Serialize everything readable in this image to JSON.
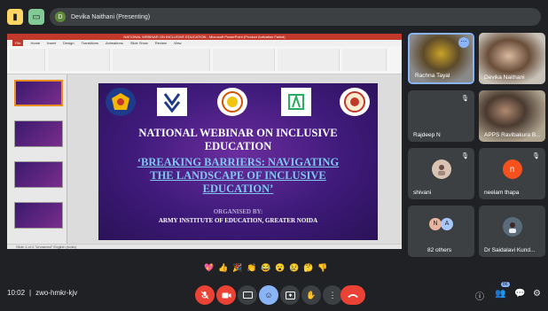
{
  "topbar": {
    "presenter_initial": "D",
    "presenting_label": "Devika Naithani (Presenting)"
  },
  "ppt": {
    "window_title": "NATIONAL WEBINAR ON INCLUSIVE EDUCATION - Microsoft PowerPoint (Product Activation Failed)",
    "tabs": [
      "File",
      "Home",
      "Insert",
      "Design",
      "Transitions",
      "Animations",
      "Slide Show",
      "Review",
      "View"
    ],
    "status_text": "Slide 1 of 4   \"Unnamed\"   English (India)"
  },
  "slide": {
    "title_line1": "NATIONAL WEBINAR ON INCLUSIVE",
    "title_line2": "EDUCATION",
    "subtitle_line1": "‘BREAKING BARRIERS: NAVIGATING",
    "subtitle_line2": "THE LANDSCAPE OF INCLUSIVE",
    "subtitle_line3": "EDUCATION’",
    "organised_label": "ORGANISED BY:",
    "organiser": "ARMY INSTITUTE OF EDUCATION, GREATER NOIDA"
  },
  "participants": [
    {
      "name": "Rachna Tayal"
    },
    {
      "name": "Devika Naithani"
    },
    {
      "name": "Rajdeep N",
      "initial": ""
    },
    {
      "name": "APPS Ravibakura B..."
    },
    {
      "name": "shivani"
    },
    {
      "name": "neelam thapa",
      "initial": "n"
    },
    {
      "name": "82 others",
      "initials": [
        "N",
        "A"
      ]
    },
    {
      "name": "Dr Saidalavi Kund..."
    }
  ],
  "reactions": [
    "💖",
    "👍",
    "🎉",
    "👏",
    "😂",
    "😮",
    "😢",
    "🤔",
    "👎"
  ],
  "meeting": {
    "time": "10:02",
    "separator": "|",
    "code": "zwo-hmkr-kjv",
    "people_count": "86"
  },
  "colors": {
    "background": "#202124",
    "tile": "#3c4043",
    "danger": "#ea4335",
    "accent": "#8ab4f8"
  }
}
